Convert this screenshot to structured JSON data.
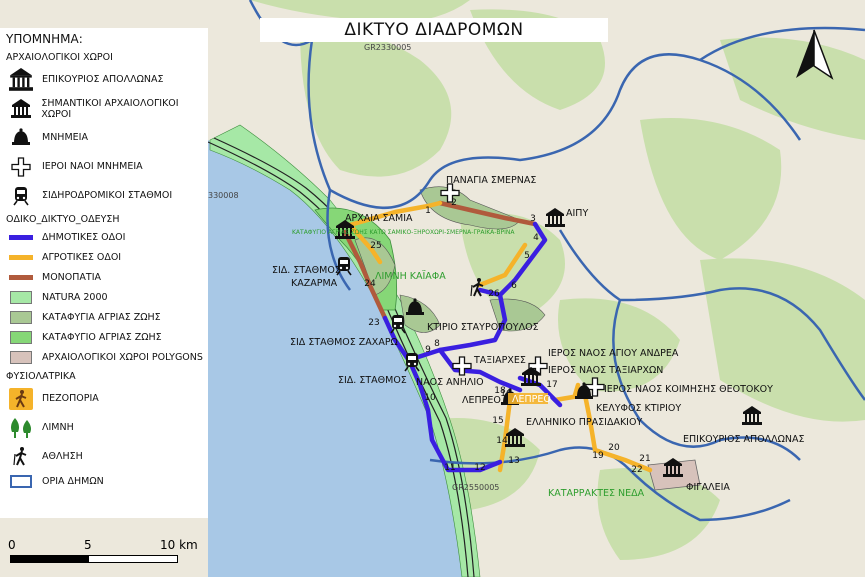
{
  "map": {
    "title": "ΔΙΚΤΥΟ ΔΙΑΔΡΟΜΩΝ",
    "colors": {
      "sea": "#a8c8e6",
      "land": "#ece8dc",
      "forest": "#c9dfac",
      "natura": "#a6e8a6",
      "refuge_dark": "#a9c894",
      "refuge_light": "#86d777",
      "municipal_road": "#3a1fe0",
      "agri_road": "#f5b32a",
      "path": "#b05a3c",
      "boundary": "#3a66b0",
      "archaeo_polygon": "#d7c2bb"
    },
    "labels": {
      "panagia": "ΠΑΝΑΓΙΑ ΣΜΕΡΝΑΣ",
      "archaia_samia": "ΑΡΧΑΙΑ ΣΑΜΙΑ",
      "aipy": "ΑΙΠΥ",
      "katafygio": "ΚΑΤΑΦΥΓΙΟ ΑΓΡΙΑΣ ΖΩΗΣ ΚΑΤΩ ΣΑΜΙΚΟ-ΞΗΡΟΧΩΡΙ-ΣΜΕΡΝΑ-ΓΡΑΙΚΑ-ΒΡΙΝΑ",
      "limni_kaiafa": "ΛΙΜΝΗ ΚΑΪΑΦΑ",
      "sid_stathmos_kazarma_1": "ΣΙΔ. ΣΤΑΘΜΟΣ",
      "sid_stathmos_kazarma_2": "ΚΑΖΑΡΜΑ",
      "ktirio": "ΚΤΙΡΙΟ ΣΤΑΥΡΟΠΟΥΛΟΣ",
      "sid_stathmos_zacharo": "ΣΙΔ ΣΤΑΘΜΟΣ ΖΑΧΑΡΩ",
      "taxiarches": "ΤΑΞΙΑΡΧΕΣ",
      "ieros_naos_andrea": "ΙΕΡΟΣ ΝΑΟΣ ΑΓΙΟΥ ΑΝΔΡΕΑ",
      "ieros_naos_taxiarchon": "ΙΕΡΟΣ ΝΑΟΣ ΤΑΞΙΑΡΧΩΝ",
      "sid_stathmos": "ΣΙΔ. ΣΤΑΘΜΟΣ",
      "naos_anilio": "ΝΑΟΣ ΑΝΗΛΙΟ",
      "ieros_naos_koimisis": "ΙΕΡΟΣ ΝΑΟΣ ΚΟΙΜΗΣΗΣ ΘΕΟΤΟΚΟΥ",
      "lepreo": "ΛΕΠΡΕΟ",
      "lepreo_tag": "ΛΕΠΡΕΟ",
      "kelyfos": "ΚΕΛΥΦΟΣ ΚΤΙΡΙΟΥ",
      "ellhniko": "ΕΛΛΗΝΙΚΟ ΠΡΑΣΙΔΑΚΙΟΥ",
      "epikourios_map": "ΕΠΙΚΟΥΡΙΟΣ ΑΠΟΛΛΩΝΑΣ",
      "fygaleia": "ΦΙΓΑΛΕΙΑ",
      "katarraktes": "ΚΑΤΑΡΡΑΚΤΕΣ ΝΕΔΑ",
      "gr1": "GR2330005",
      "gr2": "GR2550005",
      "gr3": "330008"
    },
    "route_numbers": [
      "1",
      "2",
      "3",
      "4",
      "5",
      "6",
      "7",
      "8",
      "9",
      "10",
      "11",
      "12",
      "13",
      "14",
      "15",
      "16",
      "17",
      "18",
      "19",
      "20",
      "21",
      "22",
      "23",
      "24",
      "25",
      "26"
    ]
  },
  "legend": {
    "title": "ΥΠΟΜΝΗΜΑ:",
    "archaeo_group": "ΑΡΧΑΙΟΛΟΓΙΚΟΙ ΧΩΡΟΙ",
    "archaeo_items": [
      {
        "label": "ΕΠΙΚΟΥΡΙΟΣ ΑΠΟΛΛΩΝΑΣ",
        "icon": "temple-large-icon"
      },
      {
        "label": "ΣΗΜΑΝΤΙΚΟΙ ΑΡΧΑΙΟΛΟΓΙΚΟΙ ΧΩΡΟΙ",
        "icon": "temple-icon"
      },
      {
        "label": "ΜΝΗΜΕΙΑ",
        "icon": "bell-icon"
      },
      {
        "label": "ΙΕΡΟΙ ΝΑΟΙ ΜΝΗΜΕΙΑ",
        "icon": "cross-icon"
      },
      {
        "label": "ΣΙΔΗΡΟΔΡΟΜΙΚΟΙ ΣΤΑΘΜΟΙ",
        "icon": "train-icon"
      }
    ],
    "road_group": "ΟΔΙΚΟ_ΔΙΚΤΥΟ_ΟΔΕΥΣΗ",
    "road_items": [
      {
        "label": "ΔΗΜΟΤΙΚΕΣ ΟΔΟΙ",
        "color": "#3a1fe0"
      },
      {
        "label": "ΑΓΡΟΤΙΚΕΣ ΟΔΟΙ",
        "color": "#f5b32a"
      },
      {
        "label": "ΜΟΝΟΠΑΤΙΑ",
        "color": "#b05a3c"
      }
    ],
    "area_items": [
      {
        "label": "NATURA 2000",
        "color": "#a6e8a6"
      },
      {
        "label": "ΚΑΤΑΦΥΓΙΑ ΑΓΡΙΑΣ ΖΩΗΣ",
        "color": "#a9c894"
      },
      {
        "label": "ΚΑΤΑΦΥΓΙΟ ΑΓΡΙΑΣ ΖΩΗΣ",
        "color": "#86d777"
      },
      {
        "label": "ΑΡΧΑΙΟΛΟΓΙΚΟΙ ΧΩΡΟΙ POLYGONS",
        "color": "#d7c2bb"
      }
    ],
    "nature_group": "ΦΥΣΙΟΛΑΤΡΙΚΑ",
    "nature_items": [
      {
        "label": "ΠΕΖΟΠΟΡΙΑ",
        "icon": "hiking-icon"
      },
      {
        "label": "ΛΙΜΝΗ",
        "icon": "trees-icon"
      },
      {
        "label": "ΑΘΛΗΣΗ",
        "icon": "walker-icon"
      }
    ],
    "boundary_item": {
      "label": "ΟΡΙΑ ΔΗΜΩΝ",
      "color": "#3a66b0"
    }
  },
  "scale": {
    "labels": [
      "0",
      "5",
      "10 km"
    ]
  }
}
